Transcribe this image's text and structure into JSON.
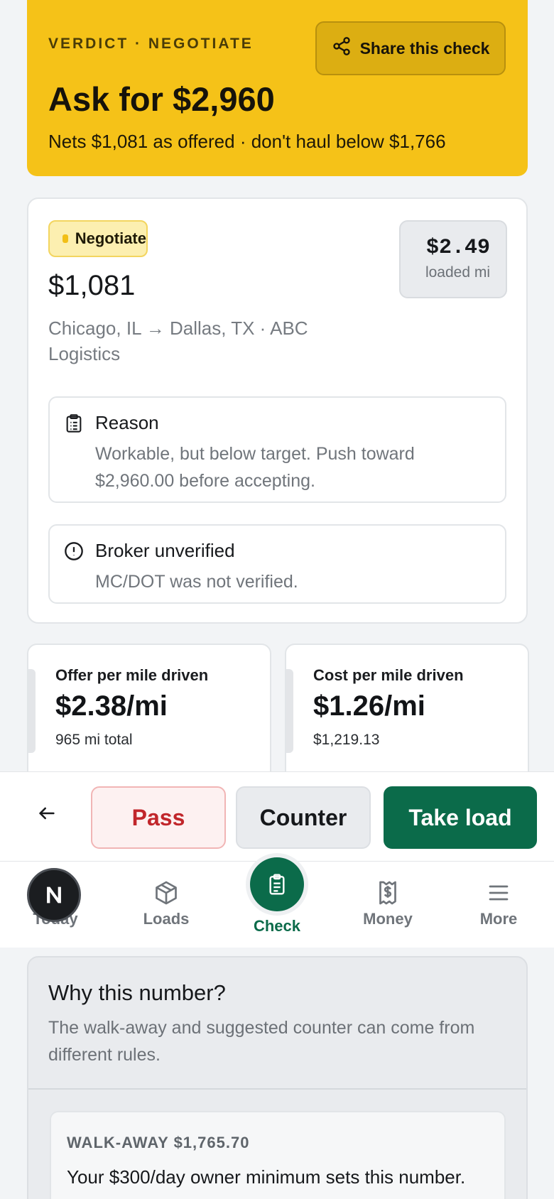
{
  "verdict": {
    "kicker": "VERDICT · NEGOTIATE",
    "title": "Ask for $2,960",
    "subtitle": "Nets $1,081 as offered · don't haul below $1,766",
    "share_label": "Share this check"
  },
  "card": {
    "badge": "Negotiate",
    "price": "$1,081",
    "route": "Chicago, IL → Dallas, TX · ABC Logistics",
    "rate_value": "$2.49",
    "rate_label": "loaded mi",
    "reason": {
      "title": "Reason",
      "text": "Workable, but below target. Push toward $2,960.00 before accepting."
    },
    "broker": {
      "title": "Broker unverified",
      "text": "MC/DOT was not verified."
    }
  },
  "metrics": [
    {
      "label": "Offer per mile driven",
      "value": "$2.38/mi",
      "sub": "965 mi total"
    },
    {
      "label": "Cost per mile driven",
      "value": "$1.26/mi",
      "sub": "$1,219.13"
    }
  ],
  "actions": {
    "pass": "Pass",
    "counter": "Counter",
    "take": "Take load"
  },
  "nav": {
    "today": "Today",
    "loads": "Loads",
    "check": "Check",
    "money": "Money",
    "more": "More"
  },
  "why": {
    "title": "Why this number?",
    "text": "The walk-away and suggested counter can come from different rules.",
    "rule_head": "WALK-AWAY $1,765.70",
    "rule_text": "Your $300/day owner minimum sets this number."
  },
  "colors": {
    "banner": "#f5c218",
    "accent_green": "#0b6b4a",
    "pass_red": "#c1262b",
    "badge_yellow": "#fcefb0"
  }
}
